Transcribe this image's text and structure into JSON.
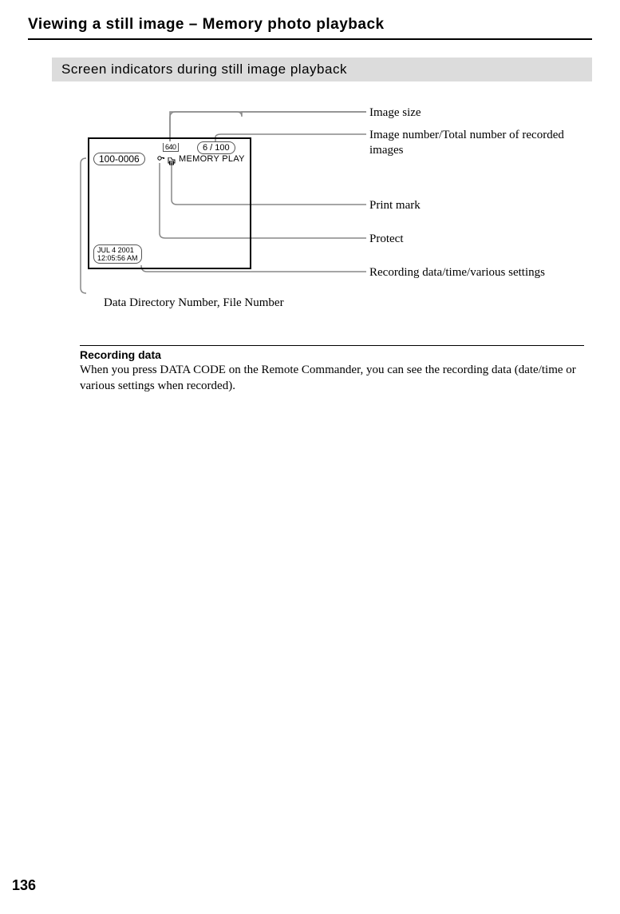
{
  "title": "Viewing a still image – Memory photo playback",
  "section_header": "Screen indicators during still image playback",
  "screen": {
    "file_number": "100-0006",
    "image_size": "640",
    "image_count": "6 / 100",
    "mode_text": "MEMORY  PLAY",
    "date_line1": "JUL  4  2001",
    "date_line2": "12:05:56 AM"
  },
  "callouts": {
    "image_size": "Image size",
    "image_number": "Image number/Total number of recorded images",
    "print_mark": "Print mark",
    "protect": "Protect",
    "recording_data": "Recording data/time/various settings",
    "data_dir": "Data Directory Number, File Number"
  },
  "recording": {
    "heading": "Recording data",
    "body": "When you press DATA CODE on the Remote Commander, you can see the recording data (date/time or various settings when recorded)."
  },
  "page_number": "136"
}
